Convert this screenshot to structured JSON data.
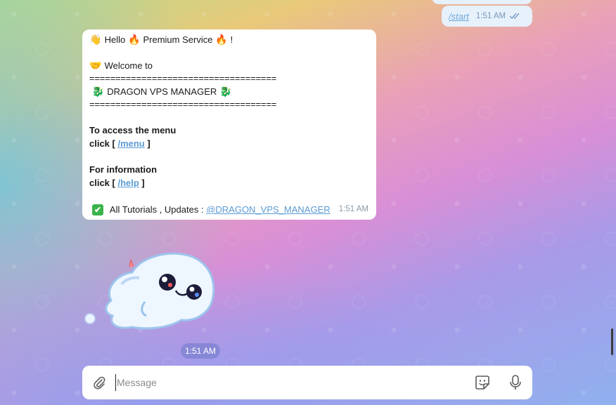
{
  "outgoing": {
    "command": "/start",
    "time": "1:51 AM",
    "status": "read"
  },
  "incoming": {
    "lines": [
      {
        "emoji": "👋",
        "text": " Hello ",
        "emoji2": "🔥",
        "text2": " Premium Service ",
        "emoji3": "🔥",
        "text3": " !"
      },
      {
        "emoji": "🤝",
        "text": " Welcome to"
      }
    ],
    "separator": "====================================",
    "title_emoji": "🐉",
    "title": " DRAGON VPS MANAGER ",
    "menu_heading": "To access the menu",
    "click_prefix": "click [ ",
    "menu_link": "/menu",
    "click_suffix": " ]",
    "info_heading": "For information",
    "help_link": "/help",
    "footer_check": "✔",
    "footer_text": " All Tutorials , Updates : ",
    "footer_mention": "@DRAGON_VPS_MANAGER",
    "time": "1:51 AM"
  },
  "sticker": {
    "time": "1:51 AM",
    "description": "ghost-sticker"
  },
  "composer": {
    "placeholder": "Message"
  },
  "colors": {
    "link": "#5b9bd5",
    "bubble_out": "#e6f1fb",
    "bubble_in": "#ffffff"
  }
}
